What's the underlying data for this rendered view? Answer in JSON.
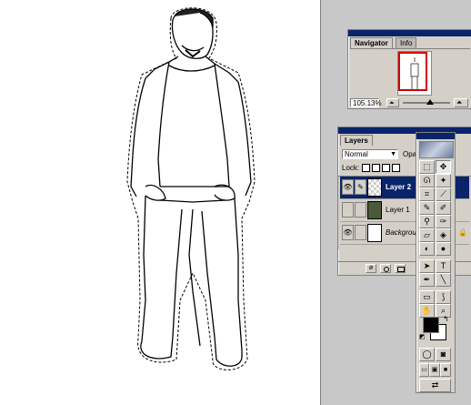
{
  "navigator": {
    "tab_active": "Navigator",
    "tab_inactive": "Info",
    "zoom": "105.13%"
  },
  "layers": {
    "title": "Layers",
    "blend_mode": "Normal",
    "opacity_label": "Opac",
    "lock_label": "Lock:",
    "items": [
      {
        "name": "Layer 2",
        "selected": true,
        "visible": true
      },
      {
        "name": "Layer 1",
        "selected": false,
        "visible": false
      },
      {
        "name": "Background",
        "selected": false,
        "visible": true
      }
    ]
  },
  "toolbox": {
    "tools": [
      {
        "icon": "marquee-icon",
        "glyph": "⬚"
      },
      {
        "icon": "move-icon",
        "glyph": "✥"
      },
      {
        "icon": "lasso-icon",
        "glyph": "ᘏ"
      },
      {
        "icon": "magic-wand-icon",
        "glyph": "✦"
      },
      {
        "icon": "crop-icon",
        "glyph": "⌗"
      },
      {
        "icon": "slice-icon",
        "glyph": "⟋"
      },
      {
        "icon": "healing-brush-icon",
        "glyph": "✎"
      },
      {
        "icon": "brush-icon",
        "glyph": "✐"
      },
      {
        "icon": "clone-stamp-icon",
        "glyph": "⚲"
      },
      {
        "icon": "history-brush-icon",
        "glyph": "✑"
      },
      {
        "icon": "eraser-icon",
        "glyph": "▱"
      },
      {
        "icon": "paint-bucket-icon",
        "glyph": "◈"
      },
      {
        "icon": "blur-icon",
        "glyph": "◐"
      },
      {
        "icon": "dodge-icon",
        "glyph": "●"
      },
      {
        "icon": "path-select-icon",
        "glyph": "➤"
      },
      {
        "icon": "type-icon",
        "glyph": "T"
      },
      {
        "icon": "pen-icon",
        "glyph": "✒"
      },
      {
        "icon": "line-icon",
        "glyph": "╲"
      },
      {
        "icon": "notes-icon",
        "glyph": "▭"
      },
      {
        "icon": "eyedropper-icon",
        "glyph": "⟆"
      },
      {
        "icon": "hand-icon",
        "glyph": "✋"
      },
      {
        "icon": "zoom-icon",
        "glyph": "⌕"
      }
    ],
    "foreground_color": "#000000",
    "background_color": "#ffffff"
  },
  "accent": "#0a246a"
}
